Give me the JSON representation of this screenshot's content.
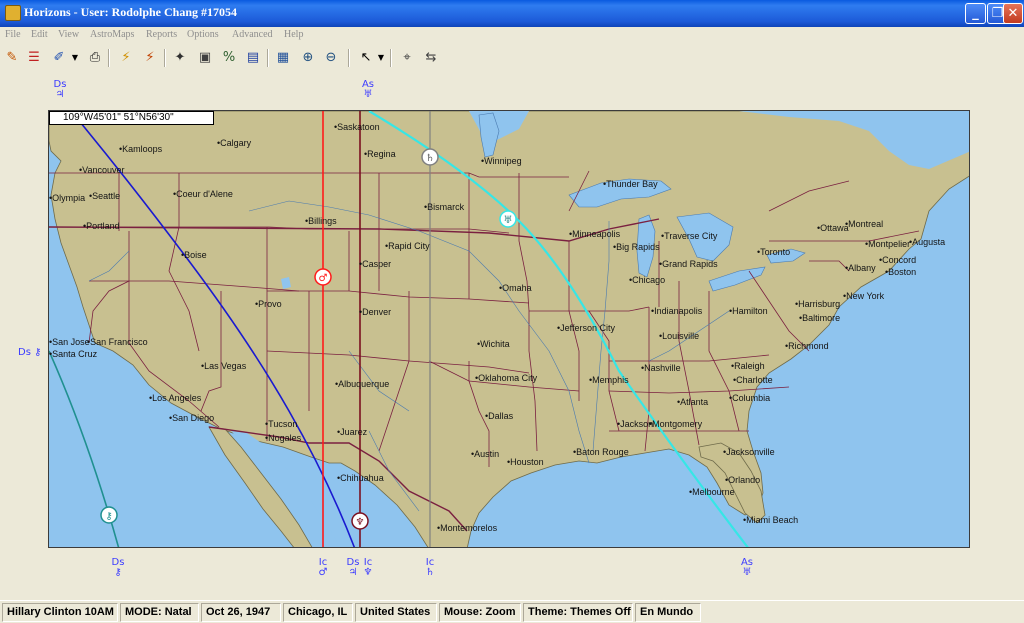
{
  "window": {
    "title": "Horizons - User: Rodolphe Chang #17054"
  },
  "menu": [
    "File",
    "Edit",
    "View",
    "AstroMaps",
    "Reports",
    "Options",
    "Advanced",
    "Help"
  ],
  "toolbar": [
    {
      "icon": "pencil-icon",
      "glyph": "✎",
      "color": "#c25400"
    },
    {
      "icon": "chart-wheel-icon",
      "glyph": "☰",
      "color": "#c02020"
    },
    {
      "icon": "notes-icon",
      "glyph": "✐",
      "color": "#2050b0"
    },
    {
      "icon": "print-icon",
      "glyph": "⎙",
      "color": "#202020"
    },
    {
      "icon": "transits-icon",
      "glyph": "⚡",
      "color": "#d09000"
    },
    {
      "icon": "progressions-icon",
      "glyph": "⚡",
      "color": "#c04000"
    },
    {
      "icon": "aspects-icon",
      "glyph": "✦",
      "color": "#303030"
    },
    {
      "icon": "window-icon",
      "glyph": "▣",
      "color": "#404040"
    },
    {
      "icon": "compare-icon",
      "glyph": "%",
      "color": "#306030"
    },
    {
      "icon": "monitor-icon",
      "glyph": "▤",
      "color": "#2040a0"
    },
    {
      "icon": "map-view-icon",
      "glyph": "▦",
      "color": "#20509a"
    },
    {
      "icon": "zoom-in-icon",
      "glyph": "⊕",
      "color": "#205080"
    },
    {
      "icon": "zoom-out-icon",
      "glyph": "⊖",
      "color": "#205080"
    },
    {
      "icon": "pointer-icon",
      "glyph": "↖",
      "color": "#000000"
    },
    {
      "icon": "locate-icon",
      "glyph": "⌖",
      "color": "#404040"
    },
    {
      "icon": "relocate-icon",
      "glyph": "⇆",
      "color": "#404040"
    }
  ],
  "map": {
    "coordinate_readout": "109°W45'01\"   51°N56'30\"",
    "cities": [
      "Kamloops",
      "Calgary",
      "Saskatoon",
      "Regina",
      "Winnipeg",
      "Vancouver",
      "Seattle",
      "Olympia",
      "Coeur d'Alene",
      "Portland",
      "Billings",
      "Bismarck",
      "Thunder Bay",
      "Boise",
      "Rapid City",
      "Minneapolis",
      "Ottawa",
      "Montreal",
      "Montpelier",
      "Augusta",
      "Traverse City",
      "Big Rapids",
      "Toronto",
      "Concord",
      "Grand Rapids",
      "Albany",
      "Boston",
      "Casper",
      "Chicago",
      "Omaha",
      "Provo",
      "Denver",
      "New York",
      "Harrisburg",
      "Hamilton",
      "Indianapolis",
      "Baltimore",
      "Jefferson City",
      "San Jose",
      "San Francisco",
      "Santa Cruz",
      "Wichita",
      "Louisville",
      "Richmond",
      "Las Vegas",
      "Raleigh",
      "Nashville",
      "Albuquerque",
      "Oklahoma City",
      "Memphis",
      "Charlotte",
      "Los Angeles",
      "Atlanta",
      "Columbia",
      "San Diego",
      "Dallas",
      "Tucson",
      "Nogales",
      "Jackson",
      "Montgomery",
      "Juarez",
      "Austin",
      "Houston",
      "Baton Rouge",
      "Jacksonville",
      "Chihuahua",
      "Orlando",
      "Melbourne",
      "Miami Beach",
      "Montemorelos"
    ],
    "lines_top": [
      {
        "angle": "Ds",
        "planet": "♃"
      },
      {
        "angle": "As",
        "planet": "♅"
      }
    ],
    "lines_bottom": [
      {
        "angle": "Ds",
        "planet": "⚷"
      },
      {
        "angle": "Ic",
        "planet": "♂"
      },
      {
        "angle": "Ds",
        "planet": "♃"
      },
      {
        "angle": "Ic",
        "planet": "♆"
      },
      {
        "angle": "Ic",
        "planet": "♄"
      },
      {
        "angle": "As",
        "planet": "♅"
      }
    ],
    "line_left": {
      "angle": "Ds",
      "planet": "⚷"
    },
    "markers": [
      "♂",
      "♄",
      "♅",
      "♆",
      "⚷"
    ],
    "colors": {
      "water": "#8fc4ee",
      "land": "#c8c090",
      "border": "#7a2040",
      "jupiter": "#1a1ad0",
      "uranus": "#36e6e6",
      "mars": "#ff1a1a",
      "neptune": "#7a1020",
      "saturn": "#808080",
      "chiron": "#209090"
    }
  },
  "status": [
    "Hillary Clinton 10AM",
    "MODE: Natal",
    "Oct 26, 1947",
    "Chicago, IL",
    "United States",
    "Mouse: Zoom",
    "Theme: Themes Off",
    "En Mundo"
  ]
}
